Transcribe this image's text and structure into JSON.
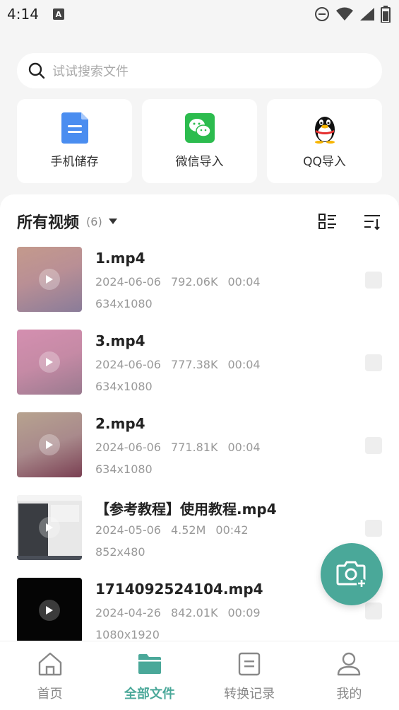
{
  "status_bar": {
    "time": "4:14",
    "a_badge": "A"
  },
  "search": {
    "placeholder": "试试搜索文件"
  },
  "sources": [
    {
      "label": "手机储存",
      "icon": "document-icon"
    },
    {
      "label": "微信导入",
      "icon": "wechat-icon"
    },
    {
      "label": "QQ导入",
      "icon": "qq-penguin-icon"
    }
  ],
  "list_header": {
    "title": "所有视频",
    "count": "(6)"
  },
  "videos": [
    {
      "name": "1.mp4",
      "date": "2024-06-06",
      "size": "792.06K",
      "duration": "00:04",
      "resolution": "634x1080"
    },
    {
      "name": "3.mp4",
      "date": "2024-06-06",
      "size": "777.38K",
      "duration": "00:04",
      "resolution": "634x1080"
    },
    {
      "name": "2.mp4",
      "date": "2024-06-06",
      "size": "771.81K",
      "duration": "00:04",
      "resolution": "634x1080"
    },
    {
      "name": "【参考教程】使用教程.mp4",
      "date": "2024-05-06",
      "size": "4.52M",
      "duration": "00:42",
      "resolution": "852x480"
    },
    {
      "name": "1714092524104.mp4",
      "date": "2024-04-26",
      "size": "842.01K",
      "duration": "00:09",
      "resolution": "1080x1920"
    }
  ],
  "bottom_nav": [
    {
      "label": "首页",
      "icon": "home-icon"
    },
    {
      "label": "全部文件",
      "icon": "folder-icon",
      "active": true
    },
    {
      "label": "转换记录",
      "icon": "record-icon"
    },
    {
      "label": "我的",
      "icon": "user-icon"
    }
  ],
  "colors": {
    "accent": "#4aa899",
    "doc_blue": "#4a8df0",
    "wechat_green": "#2cbc4e"
  }
}
